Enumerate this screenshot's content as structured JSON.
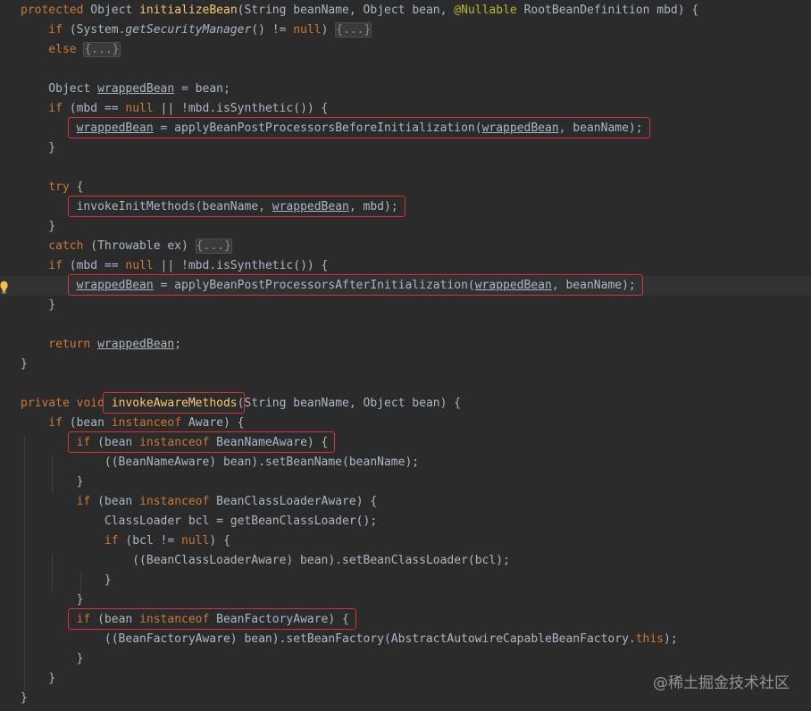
{
  "editor": {
    "theme_colors": {
      "background": "#2b2b2b",
      "text": "#a9b7c6",
      "keyword": "#cc7832",
      "method_declaration": "#ffc66d",
      "annotation": "#bbb529",
      "highlight_box": "#d6323a"
    },
    "lines": [
      {
        "indent": 0,
        "tokens": [
          {
            "text": "protected ",
            "style": "kw"
          },
          {
            "text": "Object "
          },
          {
            "text": "initializeBean",
            "style": "fn"
          },
          {
            "text": "(String beanName, Object bean, "
          },
          {
            "text": "@Nullable",
            "style": "ann"
          },
          {
            "text": " RootBeanDefinition mbd) {"
          }
        ]
      },
      {
        "indent": 1,
        "tokens": [
          {
            "text": "if ",
            "style": "kw"
          },
          {
            "text": "(System."
          },
          {
            "text": "getSecurityManager",
            "style": "it"
          },
          {
            "text": "() != "
          },
          {
            "text": "null",
            "style": "kw"
          },
          {
            "text": ") "
          },
          {
            "text": "{...}",
            "style": "fold"
          }
        ]
      },
      {
        "indent": 1,
        "tokens": [
          {
            "text": "else ",
            "style": "kw"
          },
          {
            "text": "{...}",
            "style": "fold"
          }
        ]
      },
      {
        "indent": 0,
        "tokens": []
      },
      {
        "indent": 1,
        "tokens": [
          {
            "text": "Object "
          },
          {
            "text": "wrappedBean",
            "style": "ul"
          },
          {
            "text": " = bean;"
          }
        ]
      },
      {
        "indent": 1,
        "tokens": [
          {
            "text": "if ",
            "style": "kw"
          },
          {
            "text": "(mbd == "
          },
          {
            "text": "null",
            "style": "kw"
          },
          {
            "text": " || !mbd.isSynthetic()) {"
          }
        ]
      },
      {
        "indent": 2,
        "tokens": [
          {
            "text": "wrappedBean",
            "style": "ul"
          },
          {
            "text": " = applyBeanPostProcessorsBeforeInitialization("
          },
          {
            "text": "wrappedBean",
            "style": "ul"
          },
          {
            "text": ", beanName);"
          }
        ]
      },
      {
        "indent": 1,
        "tokens": [
          {
            "text": "}"
          }
        ]
      },
      {
        "indent": 0,
        "tokens": []
      },
      {
        "indent": 1,
        "tokens": [
          {
            "text": "try ",
            "style": "kw"
          },
          {
            "text": "{"
          }
        ]
      },
      {
        "indent": 2,
        "tokens": [
          {
            "text": "invokeInitMethods(beanName, "
          },
          {
            "text": "wrappedBean",
            "style": "ul"
          },
          {
            "text": ", mbd);"
          }
        ]
      },
      {
        "indent": 1,
        "tokens": [
          {
            "text": "}"
          }
        ]
      },
      {
        "indent": 1,
        "tokens": [
          {
            "text": "catch ",
            "style": "kw"
          },
          {
            "text": "(Throwable ex) "
          },
          {
            "text": "{...}",
            "style": "fold"
          }
        ]
      },
      {
        "indent": 1,
        "tokens": [
          {
            "text": "if ",
            "style": "kw"
          },
          {
            "text": "(mbd == "
          },
          {
            "text": "null",
            "style": "kw"
          },
          {
            "text": " || !mbd.isSynthetic()) {"
          }
        ]
      },
      {
        "indent": 2,
        "highlight": true,
        "tokens": [
          {
            "text": "wrappedBean",
            "style": "ul"
          },
          {
            "text": " = applyBeanPostProcessorsAfterInitialization("
          },
          {
            "text": "wrappedBean",
            "style": "ul"
          },
          {
            "text": ", beanName);"
          }
        ]
      },
      {
        "indent": 1,
        "tokens": [
          {
            "text": "}"
          }
        ]
      },
      {
        "indent": 0,
        "tokens": []
      },
      {
        "indent": 1,
        "tokens": [
          {
            "text": "return ",
            "style": "kw"
          },
          {
            "text": "wrappedBean",
            "style": "ul"
          },
          {
            "text": ";"
          }
        ]
      },
      {
        "indent": 0,
        "tokens": [
          {
            "text": "}"
          }
        ]
      },
      {
        "indent": 0,
        "tokens": []
      },
      {
        "indent": 0,
        "tokens": [
          {
            "text": "private void ",
            "style": "kw"
          },
          {
            "text": "invokeAwareMethods",
            "style": "fn"
          },
          {
            "text": "(String beanName, Object bean) {"
          }
        ]
      },
      {
        "indent": 1,
        "tokens": [
          {
            "text": "if ",
            "style": "kw"
          },
          {
            "text": "(bean "
          },
          {
            "text": "instanceof ",
            "style": "kw"
          },
          {
            "text": "Aware) {"
          }
        ]
      },
      {
        "indent": 2,
        "tokens": [
          {
            "text": "if ",
            "style": "kw"
          },
          {
            "text": "(bean "
          },
          {
            "text": "instanceof ",
            "style": "kw"
          },
          {
            "text": "BeanNameAware) {"
          }
        ]
      },
      {
        "indent": 3,
        "tokens": [
          {
            "text": "((BeanNameAware) bean).setBeanName(beanName);"
          }
        ]
      },
      {
        "indent": 2,
        "tokens": [
          {
            "text": "}"
          }
        ]
      },
      {
        "indent": 2,
        "tokens": [
          {
            "text": "if ",
            "style": "kw"
          },
          {
            "text": "(bean "
          },
          {
            "text": "instanceof ",
            "style": "kw"
          },
          {
            "text": "BeanClassLoaderAware) {"
          }
        ]
      },
      {
        "indent": 3,
        "tokens": [
          {
            "text": "ClassLoader bcl = getBeanClassLoader();"
          }
        ]
      },
      {
        "indent": 3,
        "tokens": [
          {
            "text": "if ",
            "style": "kw"
          },
          {
            "text": "(bcl != "
          },
          {
            "text": "null",
            "style": "kw"
          },
          {
            "text": ") {"
          }
        ]
      },
      {
        "indent": 4,
        "tokens": [
          {
            "text": "((BeanClassLoaderAware) bean).setBeanClassLoader(bcl);"
          }
        ]
      },
      {
        "indent": 3,
        "tokens": [
          {
            "text": "}"
          }
        ]
      },
      {
        "indent": 2,
        "tokens": [
          {
            "text": "}"
          }
        ]
      },
      {
        "indent": 2,
        "tokens": [
          {
            "text": "if ",
            "style": "kw"
          },
          {
            "text": "(bean "
          },
          {
            "text": "instanceof ",
            "style": "kw"
          },
          {
            "text": "BeanFactoryAware) {"
          }
        ]
      },
      {
        "indent": 3,
        "tokens": [
          {
            "text": "((BeanFactoryAware) bean).setBeanFactory(AbstractAutowireCapableBeanFactory."
          },
          {
            "text": "this",
            "style": "kw"
          },
          {
            "text": ");"
          }
        ]
      },
      {
        "indent": 2,
        "tokens": [
          {
            "text": "}"
          }
        ]
      },
      {
        "indent": 1,
        "tokens": [
          {
            "text": "}"
          }
        ]
      },
      {
        "indent": 0,
        "tokens": [
          {
            "text": "}"
          }
        ]
      }
    ],
    "highlight_boxes": [
      {
        "line": 6,
        "label": "before-initialization-call"
      },
      {
        "line": 10,
        "label": "invoke-init-methods-call"
      },
      {
        "line": 14,
        "label": "after-initialization-call"
      },
      {
        "line": 20,
        "label": "invoke-aware-methods-name"
      },
      {
        "line": 22,
        "label": "bean-name-aware-check"
      },
      {
        "line": 31,
        "label": "bean-factory-aware-check"
      }
    ],
    "gutter_icon": "lightbulb-icon"
  },
  "watermark": {
    "text": "@稀土掘金技术社区"
  }
}
